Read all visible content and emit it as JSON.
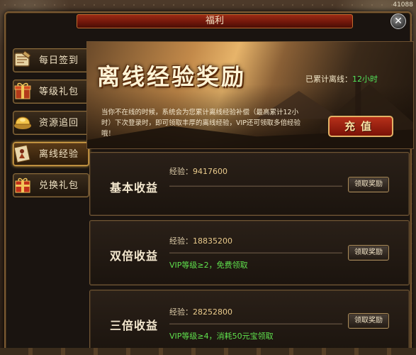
{
  "window": {
    "title": "福利",
    "corner_number": "41088"
  },
  "sidebar": {
    "items": [
      {
        "label": "每日签到",
        "icon": "calendar-scroll-icon",
        "active": false
      },
      {
        "label": "等级礼包",
        "icon": "gift-box-icon",
        "active": false
      },
      {
        "label": "资源追回",
        "icon": "gold-ingot-icon",
        "active": false
      },
      {
        "label": "离线经验",
        "icon": "scroll-figure-icon",
        "active": true
      },
      {
        "label": "兑换礼包",
        "icon": "red-gift-icon",
        "active": false
      }
    ]
  },
  "banner": {
    "title": "离线经验奖励",
    "accumulated_label": "已累计离线：",
    "accumulated_value": "12小时",
    "description": "当你不在线的时候，系统会为您累计离线经验补偿（最高累计12小时）下次登录时，即可领取丰厚的离线经验，VIP还可领取多倍经验哦！",
    "recharge_label": "充值"
  },
  "rewards": [
    {
      "title": "基本收益",
      "exp_label": "经验：",
      "exp_value": "9417600",
      "note": "",
      "button": "领取奖励"
    },
    {
      "title": "双倍收益",
      "exp_label": "经验：",
      "exp_value": "18835200",
      "note": "VIP等级≥2，免费领取",
      "button": "领取奖励"
    },
    {
      "title": "三倍收益",
      "exp_label": "经验：",
      "exp_value": "28252800",
      "note": "VIP等级≥4，消耗50元宝领取",
      "button": "领取奖励"
    }
  ],
  "colors": {
    "accent_green": "#52e35a",
    "title_red": "#9b2a14",
    "gold_border": "#d8a548"
  }
}
